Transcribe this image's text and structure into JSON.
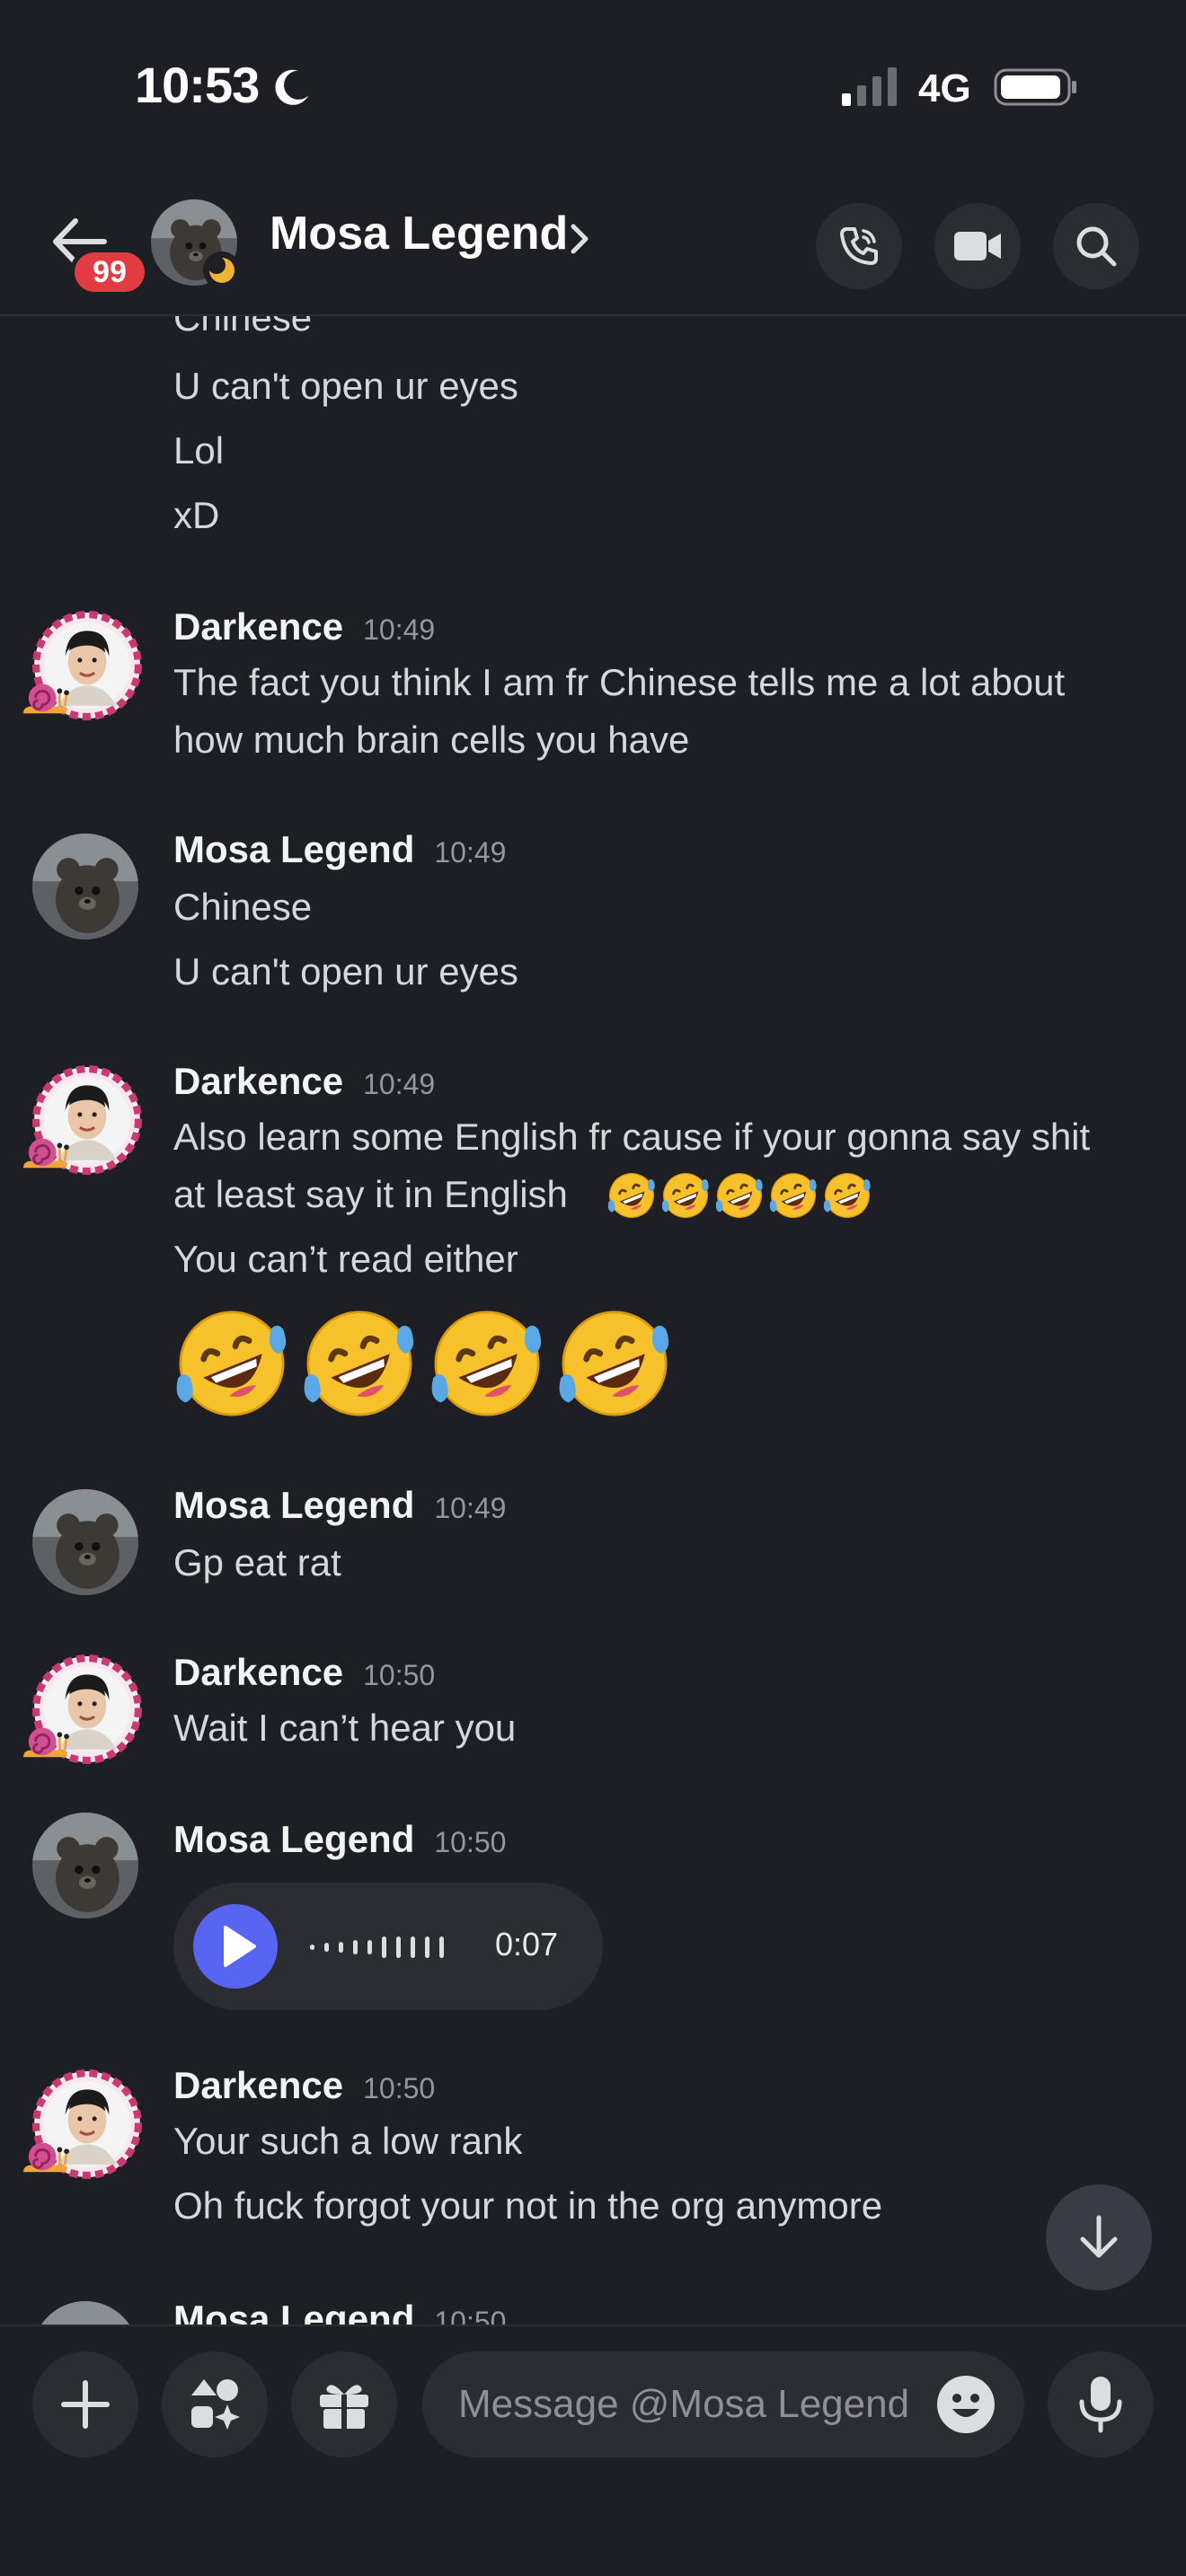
{
  "status": {
    "time": "10:53",
    "network": "4G"
  },
  "header": {
    "title": "Mosa Legend",
    "badge": "99"
  },
  "messages": {
    "top_lines": [
      "Chinese",
      "U can't open ur eyes",
      "Lol",
      "xD"
    ],
    "m1": {
      "author": "Darkence",
      "time": "10:49",
      "lines": [
        "The fact you think I am fr Chinese tells me a lot about",
        "how much brain cells you have"
      ]
    },
    "m2": {
      "author": "Mosa Legend",
      "time": "10:49",
      "lines": [
        "Chinese",
        "U can't open ur eyes"
      ]
    },
    "m3": {
      "author": "Darkence",
      "time": "10:49",
      "lines": [
        "Also learn some English fr cause if your gonna say shit",
        "at least say it in English",
        "You can’t read either"
      ]
    },
    "m4": {
      "author": "Mosa Legend",
      "time": "10:49",
      "lines": [
        "Gp eat rat"
      ]
    },
    "m5": {
      "author": "Darkence",
      "time": "10:50",
      "lines": [
        "Wait I can’t hear you"
      ]
    },
    "m6": {
      "author": "Mosa Legend",
      "time": "10:50",
      "voice_duration": "0:07"
    },
    "m7": {
      "author": "Darkence",
      "time": "10:50",
      "lines": [
        "Your such a low rank",
        "Oh fuck forgot your not in the org anymore"
      ]
    },
    "m8": {
      "author": "Mosa Legend",
      "time": "10:50"
    }
  },
  "composer": {
    "placeholder": "Message @Mosa Legend"
  },
  "colors": {
    "accent": "#5865f2",
    "badge": "#e23c42",
    "background": "#1e1f24"
  },
  "icons": [
    "back-arrow-icon",
    "phone-icon",
    "video-icon",
    "search-icon",
    "plus-icon",
    "apps-icon",
    "gift-icon",
    "emoji-icon",
    "microphone-icon",
    "arrow-down-icon",
    "play-icon"
  ]
}
